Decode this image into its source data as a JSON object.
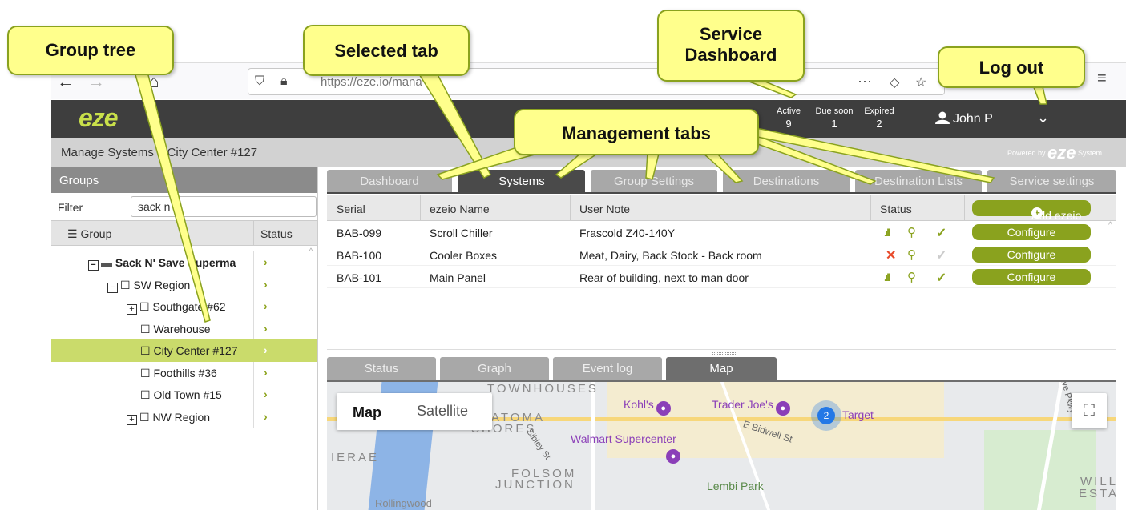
{
  "browser": {
    "back": "←",
    "forward": "→",
    "home": "⌂",
    "url": "https://eze.io/mana",
    "url_domain": "eze.io",
    "more": "···",
    "menu": "≡"
  },
  "header": {
    "logo": "eze",
    "counters": [
      {
        "label": "Active",
        "value": "9"
      },
      {
        "label": "Due soon",
        "value": "1"
      },
      {
        "label": "Expired",
        "value": "2"
      }
    ],
    "user": "John P",
    "chevron": "⌄"
  },
  "breadcrumb": "Manage Systems :: City Center #127",
  "powered": {
    "label": "Powered by",
    "brand": "eze",
    "suffix": "System"
  },
  "groups": {
    "title": "Groups",
    "filter_label": "Filter",
    "filter_value": "sack n",
    "col_group": "Group",
    "col_status": "Status",
    "items": [
      {
        "label": "Sack N' Save Superma",
        "toggle": "−",
        "folder": "▪",
        "status": "›",
        "bold": true
      },
      {
        "label": "SW Region",
        "toggle": "−",
        "folder": "☐",
        "status": "›"
      },
      {
        "label": "Southgate #62",
        "toggle": "+",
        "folder": "☐",
        "status": "›"
      },
      {
        "label": "Warehouse",
        "toggle": "",
        "folder": "☐",
        "status": "›"
      },
      {
        "label": "City Center #127",
        "toggle": "",
        "folder": "☐",
        "status": "›",
        "selected": true
      },
      {
        "label": "Foothills #36",
        "toggle": "",
        "folder": "☐",
        "status": "›"
      },
      {
        "label": "Old Town #15",
        "toggle": "",
        "folder": "☐",
        "status": "›"
      },
      {
        "label": "NW Region",
        "toggle": "+",
        "folder": "☐",
        "status": "›"
      }
    ]
  },
  "tabs": [
    {
      "label": "Dashboard"
    },
    {
      "label": "Systems",
      "active": true
    },
    {
      "label": "Group Settings"
    },
    {
      "label": "Destinations"
    },
    {
      "label": "Destination Lists"
    },
    {
      "label": "Service settings"
    }
  ],
  "systems": {
    "columns": [
      "Serial",
      "ezeio Name",
      "User Note",
      "Status"
    ],
    "add_label": "Add ezeio",
    "configure_label": "Configure",
    "rows": [
      {
        "serial": "BAB-099",
        "name": "Scroll Chiller",
        "note": "Frascold Z40-140Y",
        "status": "ok"
      },
      {
        "serial": "BAB-100",
        "name": "Cooler Boxes",
        "note": "Meat, Dairy, Back Stock - Back room",
        "status": "offline"
      },
      {
        "serial": "BAB-101",
        "name": "Main Panel",
        "note": "Rear of building, next to man door",
        "status": "ok"
      }
    ]
  },
  "bottom_tabs": [
    {
      "label": "Status"
    },
    {
      "label": "Graph"
    },
    {
      "label": "Event log"
    },
    {
      "label": "Map",
      "active": true
    }
  ],
  "map": {
    "type_map": "Map",
    "type_satellite": "Satellite",
    "fullscreen": "⛶",
    "cluster_count": "2",
    "labels": [
      "TOWNHOUSES",
      "ATOMA",
      "SHORES",
      "IERAE",
      "FOLSOM",
      "JUNCTION",
      "WILL",
      "ESTA",
      "Rollingwood"
    ],
    "pois": [
      "Kohl's",
      "Trader Joe's",
      "Target",
      "Walmart Supercenter",
      "Lembi Park"
    ],
    "streets": [
      "E Bidwell St",
      "Sibley St",
      "Ave Pkwy"
    ]
  },
  "callouts": {
    "group_tree": "Group tree",
    "selected_tab": "Selected tab",
    "service_dashboard": "Service Dashboard",
    "log_out": "Log out",
    "management_tabs": "Management tabs"
  },
  "colors": {
    "accent": "#8aa21e",
    "selected_row": "#cadb6b",
    "header": "#3e3e3e",
    "callout_bg": "#ffff8c",
    "error": "#e84a2a"
  }
}
